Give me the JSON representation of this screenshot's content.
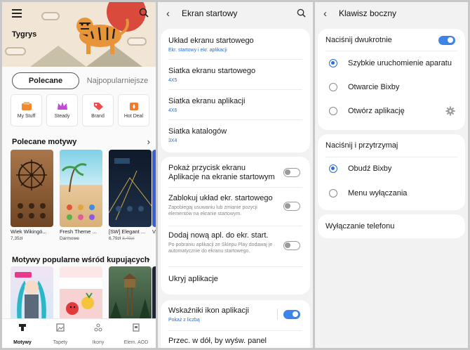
{
  "themes": {
    "banner_title": "Tygrys",
    "tabs": [
      "Polecane",
      "Najpopularniejsze"
    ],
    "categories": [
      {
        "label": "My Stuff",
        "icon": "inbox-icon",
        "color": "#f08a2c"
      },
      {
        "label": "Steady",
        "icon": "crown-icon",
        "color": "#c34ad6"
      },
      {
        "label": "Brand",
        "icon": "tag-icon",
        "color": "#e94d4d"
      },
      {
        "label": "Hot Deal",
        "icon": "fire-icon",
        "color": "#f07a30"
      }
    ],
    "section1": "Polecane motywy",
    "section2": "Motywy popularne wśród kupujących",
    "items": [
      {
        "name": "Wiek Wikingó...",
        "price": "7,35zł",
        "old_price": ""
      },
      {
        "name": "Fresh Theme ...",
        "price": "Darmowe",
        "old_price": ""
      },
      {
        "name": "[SW] Elegant ...",
        "price": "6,79zł",
        "old_price": "8,49zł"
      },
      {
        "name": "V",
        "price": "",
        "old_price": ""
      }
    ],
    "nav": [
      {
        "label": "Motywy",
        "icon": "themes-icon"
      },
      {
        "label": "Tapety",
        "icon": "wallpaper-icon"
      },
      {
        "label": "Ikony",
        "icon": "icons-icon"
      },
      {
        "label": "Elem. AOD",
        "icon": "aod-icon"
      }
    ]
  },
  "home": {
    "title": "Ekran startowy",
    "rows": [
      {
        "title": "Układ ekranu startowego",
        "sub": "Ekr. startowy i ekr. aplikacji"
      },
      {
        "title": "Siatka ekranu startowego",
        "sub": "4X5"
      },
      {
        "title": "Siatka ekranu aplikacji",
        "sub": "4X6"
      },
      {
        "title": "Siatka katalogów",
        "sub": "3X4"
      }
    ],
    "toggles": [
      {
        "title": "Pokaż przycisk ekranu Aplikacje na ekranie startowym",
        "desc": "",
        "on": false
      },
      {
        "title": "Zablokuj układ ekr. startowego",
        "desc": "Zapobiegaj usuwaniu lub zmianie pozycji elementów na ekranie startowym.",
        "on": false
      },
      {
        "title": "Dodaj nową apl. do ekr. start.",
        "desc": "Po pobraniu aplikacji ze Sklepu Play dodawaj je automatycznie do ekranu startowego.",
        "on": false
      }
    ],
    "hide_apps": "Ukryj aplikacje",
    "badges_title": "Wskaźniki ikon aplikacji",
    "badges_sub": "Pokaż z liczbą",
    "badges_on": true,
    "cut_row": "Przec. w dół, by wyśw. panel"
  },
  "side": {
    "title": "Klawisz boczny",
    "double_press": "Naciśnij dwukrotnie",
    "double_on": true,
    "double_options": [
      "Szybkie uruchomienie aparatu",
      "Otwarcie Bixby",
      "Otwórz aplikację"
    ],
    "double_selected": 0,
    "hold": "Naciśnij i przytrzymaj",
    "hold_options": [
      "Obudź Bixby",
      "Menu wyłączania"
    ],
    "hold_selected": 0,
    "power_off": "Wyłączanie telefonu"
  }
}
